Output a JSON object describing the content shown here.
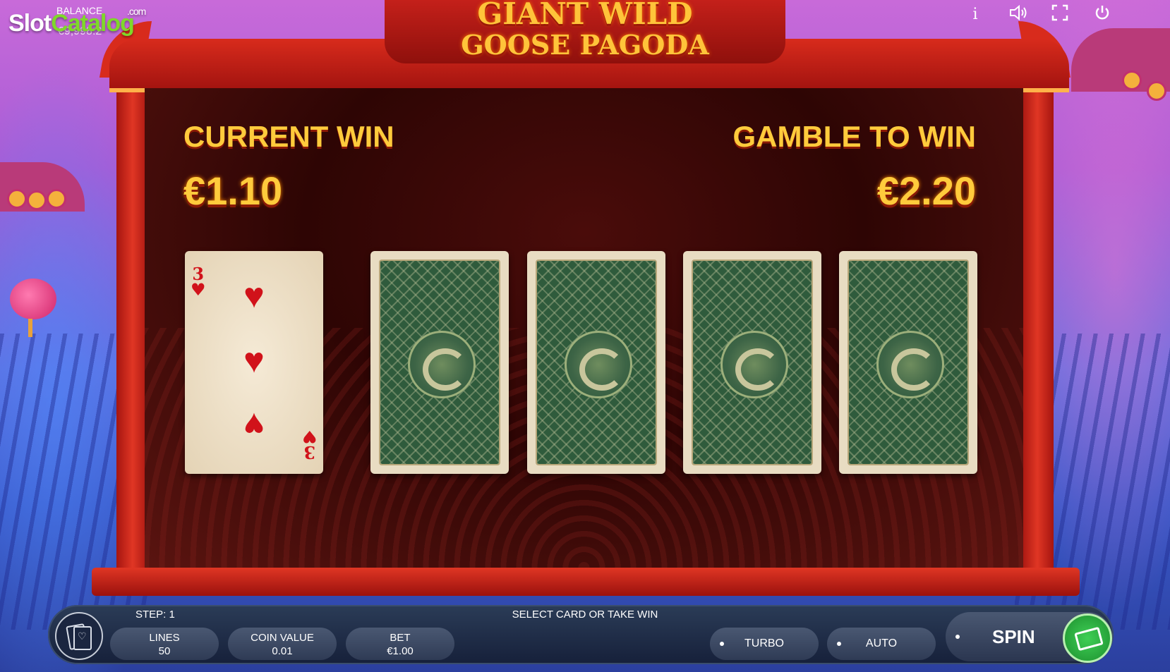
{
  "watermark": {
    "brand_slot": "Slot",
    "brand_catalog": "Catalog",
    "brand_com": ".com"
  },
  "balance": {
    "label": "BALANCE",
    "value": "€9,998.2"
  },
  "title": {
    "line1": "GIANT WILD",
    "line2": "GOOSE PAGODA"
  },
  "top_icons": [
    "info-icon",
    "sound-icon",
    "fullscreen-icon",
    "power-icon"
  ],
  "gamble": {
    "current_win_label": "CURRENT WIN",
    "current_win_value": "€1.10",
    "gamble_to_win_label": "GAMBLE TO WIN",
    "gamble_to_win_value": "€2.20"
  },
  "dealer_card": {
    "rank": "3",
    "suit": "♥",
    "color": "#d1121a"
  },
  "face_down_cards": 4,
  "bottom_bar": {
    "step": "STEP: 1",
    "message": "SELECT CARD OR TAKE WIN",
    "lines_label": "LINES",
    "lines_value": "50",
    "coin_label": "COIN VALUE",
    "coin_value": "0.01",
    "bet_label": "BET",
    "bet_value": "€1.00",
    "turbo": "TURBO",
    "auto": "AUTO",
    "spin": "SPIN"
  },
  "colors": {
    "gold": "#ffcb3c",
    "frame_red": "#d82b1c",
    "spin_green": "#3fcf55"
  }
}
